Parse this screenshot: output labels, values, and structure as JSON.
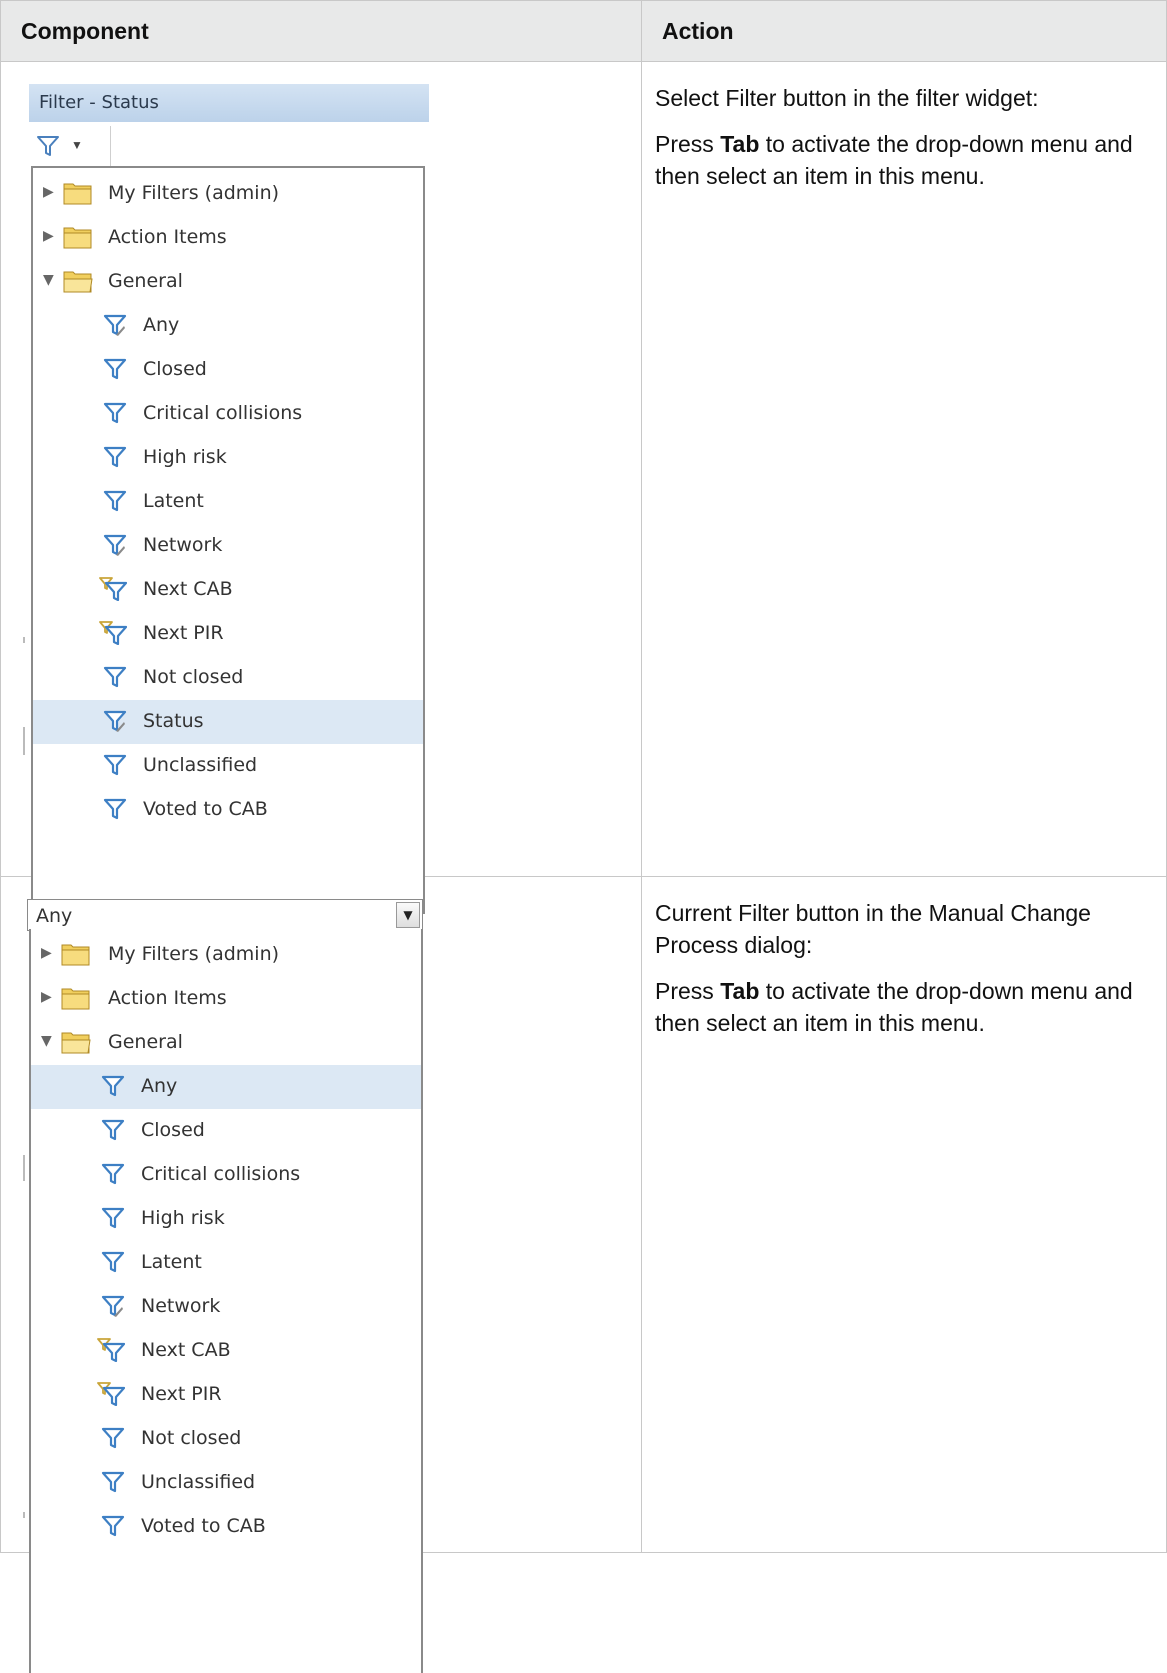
{
  "table": {
    "headers": [
      "Component",
      "Action"
    ]
  },
  "widget1": {
    "header": "Filter - Status",
    "icons": {
      "filter_button": "filter-icon",
      "caret": "dropdown-caret-icon"
    },
    "folders": [
      {
        "label": "My Filters (admin)",
        "expanded": false
      },
      {
        "label": "Action Items",
        "expanded": false
      },
      {
        "label": "General",
        "expanded": true
      }
    ],
    "items": [
      {
        "label": "Any",
        "icon": "filter-shared-icon",
        "selected": false
      },
      {
        "label": "Closed",
        "icon": "filter-icon",
        "selected": false
      },
      {
        "label": "Critical collisions",
        "icon": "filter-icon",
        "selected": false
      },
      {
        "label": "High risk",
        "icon": "filter-icon",
        "selected": false
      },
      {
        "label": "Latent",
        "icon": "filter-icon",
        "selected": false
      },
      {
        "label": "Network",
        "icon": "filter-shared-icon",
        "selected": false
      },
      {
        "label": "Next CAB",
        "icon": "filter-composite-icon",
        "selected": false
      },
      {
        "label": "Next PIR",
        "icon": "filter-composite-icon",
        "selected": false
      },
      {
        "label": "Not closed",
        "icon": "filter-icon",
        "selected": false
      },
      {
        "label": "Status",
        "icon": "filter-shared-icon",
        "selected": true
      },
      {
        "label": "Unclassified",
        "icon": "filter-icon",
        "selected": false
      },
      {
        "label": "Voted to CAB",
        "icon": "filter-icon",
        "selected": false
      }
    ],
    "action_intro": "Select Filter button in the filter widget:",
    "action_pre": "Press ",
    "action_key": "Tab",
    "action_post": " to activate the drop-down menu and then select an item in this menu."
  },
  "widget2": {
    "combo_value": "Any",
    "folders": [
      {
        "label": "My Filters (admin)",
        "expanded": false
      },
      {
        "label": "Action Items",
        "expanded": false
      },
      {
        "label": "General",
        "expanded": true
      }
    ],
    "items": [
      {
        "label": "Any",
        "icon": "filter-icon",
        "selected": true
      },
      {
        "label": "Closed",
        "icon": "filter-icon",
        "selected": false
      },
      {
        "label": "Critical collisions",
        "icon": "filter-icon",
        "selected": false
      },
      {
        "label": "High risk",
        "icon": "filter-icon",
        "selected": false
      },
      {
        "label": "Latent",
        "icon": "filter-icon",
        "selected": false
      },
      {
        "label": "Network",
        "icon": "filter-shared-icon",
        "selected": false
      },
      {
        "label": "Next CAB",
        "icon": "filter-composite-icon",
        "selected": false
      },
      {
        "label": "Next PIR",
        "icon": "filter-composite-icon",
        "selected": false
      },
      {
        "label": "Not closed",
        "icon": "filter-icon",
        "selected": false
      },
      {
        "label": "Unclassified",
        "icon": "filter-icon",
        "selected": false
      },
      {
        "label": "Voted to CAB",
        "icon": "filter-icon",
        "selected": false
      }
    ],
    "action_intro": "Current Filter button in the Manual Change Process dialog:",
    "action_pre": "Press ",
    "action_key": "Tab",
    "action_post": " to activate the drop-down menu and then select an item in this menu."
  },
  "colors": {
    "selection": "#dce8f4",
    "filter_blue": "#3d7fc4",
    "filter_gold": "#c9a53a",
    "folder_yellow": "#f1cf5e"
  }
}
